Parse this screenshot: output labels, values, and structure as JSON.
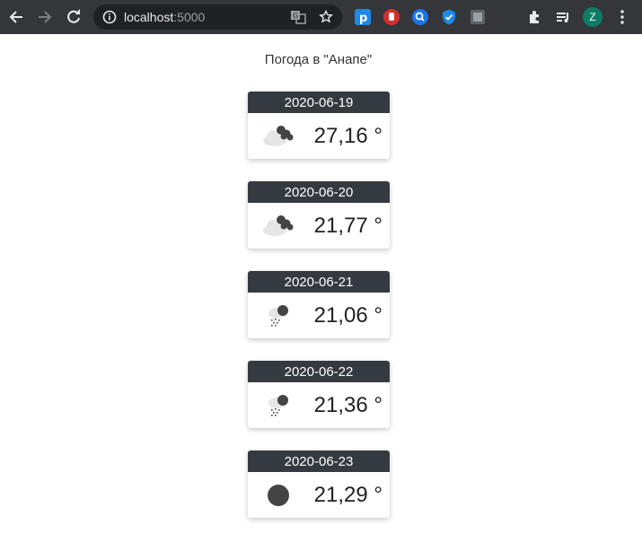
{
  "browser": {
    "url_host": "localhost",
    "url_port": ":5000",
    "avatar_letter": "Z"
  },
  "page": {
    "title": "Погода в \"Анапе\""
  },
  "forecast": [
    {
      "date": "2020-06-19",
      "temp": "27,16 °",
      "icon": "cloudy-icon"
    },
    {
      "date": "2020-06-20",
      "temp": "21,77 °",
      "icon": "cloudy-icon"
    },
    {
      "date": "2020-06-21",
      "temp": "21,06 °",
      "icon": "rain-icon"
    },
    {
      "date": "2020-06-22",
      "temp": "21,36 °",
      "icon": "rain-icon"
    },
    {
      "date": "2020-06-23",
      "temp": "21,29 °",
      "icon": "clear-icon"
    }
  ],
  "colors": {
    "toolbar": "#35363a",
    "omnibox": "#202124",
    "card_header": "#343a40",
    "avatar": "#0d7c66"
  }
}
